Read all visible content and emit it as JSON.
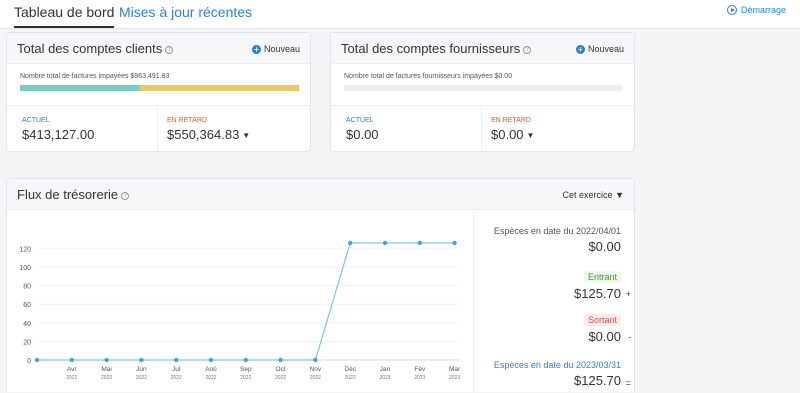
{
  "tabs": {
    "active": "Tableau de bord",
    "link": "Mises à jour récentes"
  },
  "start": {
    "label": "Démarrage"
  },
  "customers": {
    "title": "Total des comptes clients",
    "new_label": "Nouveau",
    "unpaid_text": "Nombre total de factures impayées $963,491.83",
    "current_label": "ACTUEL",
    "current_amount": "$413,127.00",
    "late_label": "EN RETARD",
    "late_amount": "$550,364.83",
    "current_fraction": 0.429
  },
  "suppliers": {
    "title": "Total des comptes fournisseurs",
    "new_label": "Nouveau",
    "unpaid_text": "Nombre total de factures fournisseurs impayées $0.00",
    "current_label": "ACTUEL",
    "current_amount": "$0.00",
    "late_label": "EN RETARD",
    "late_amount": "$0.00"
  },
  "cashflow": {
    "title": "Flux de trésorerie",
    "period": "Cet exercice",
    "opening_label": "Espèces en date du 2022/04/01",
    "opening_amount": "$0.00",
    "in_label": "Entrant",
    "in_amount": "$125.70",
    "in_sign": "+",
    "out_label": "Sortant",
    "out_amount": "$0.00",
    "out_sign": "-",
    "closing_label": "Espèces en date du 2023/03/31",
    "closing_amount": "$125.70",
    "closing_sign": "="
  },
  "colors": {
    "accent": "#2f7fd3",
    "current_bar": "#7ecbc6",
    "late_bar": "#e7c96a",
    "in": "#4a9a2e",
    "out": "#d9534f",
    "line": "#7fc3e8"
  },
  "chart_data": {
    "type": "line",
    "categories": [
      "",
      "Avr",
      "Mai",
      "Jun",
      "Jul",
      "Aoû",
      "Sep",
      "Oct",
      "Nov",
      "Déc",
      "Jan",
      "Fév",
      "Mar"
    ],
    "years": [
      "",
      "2022",
      "2022",
      "2022",
      "2022",
      "2022",
      "2022",
      "2022",
      "2022",
      "2022",
      "2023",
      "2023",
      "2023"
    ],
    "values": [
      0,
      0,
      0,
      0,
      0,
      0,
      0,
      0,
      0,
      125.7,
      125.7,
      125.7,
      125.7
    ],
    "yticks": [
      0,
      20,
      40,
      60,
      80,
      100,
      120
    ],
    "ylim": [
      0,
      130
    ],
    "grid": true
  }
}
